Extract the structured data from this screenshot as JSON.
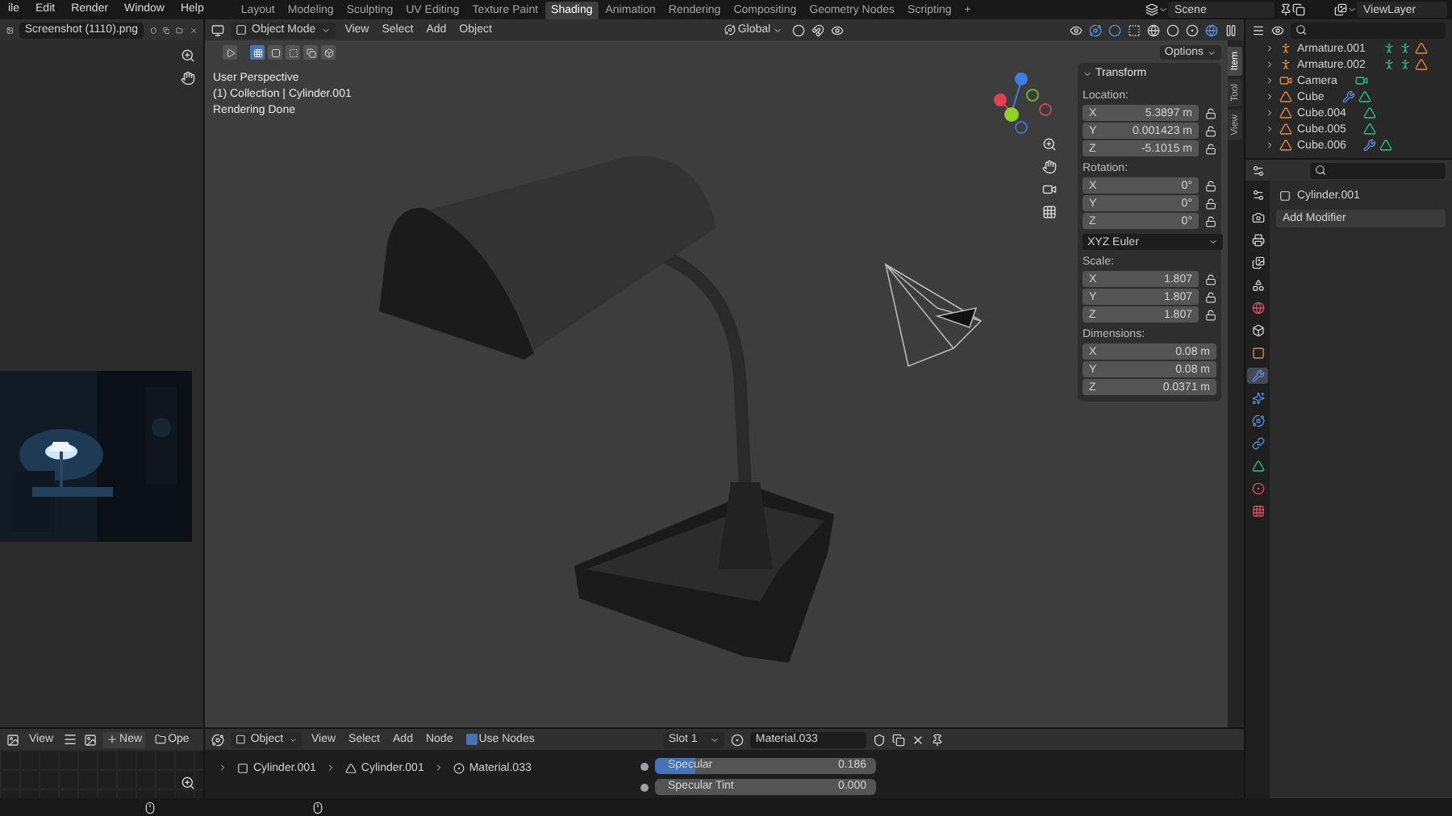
{
  "menus": [
    "ile",
    "Edit",
    "Render",
    "Window",
    "Help"
  ],
  "workspaces": [
    {
      "label": "Layout",
      "selected": false
    },
    {
      "label": "Modeling",
      "selected": false
    },
    {
      "label": "Sculpting",
      "selected": false
    },
    {
      "label": "UV Editing",
      "selected": false
    },
    {
      "label": "Texture Paint",
      "selected": false
    },
    {
      "label": "Shading",
      "selected": true
    },
    {
      "label": "Animation",
      "selected": false
    },
    {
      "label": "Rendering",
      "selected": false
    },
    {
      "label": "Compositing",
      "selected": false
    },
    {
      "label": "Geometry Nodes",
      "selected": false
    },
    {
      "label": "Scripting",
      "selected": false
    }
  ],
  "add_workspace": "+",
  "scene": {
    "name": "Scene",
    "view_layer": "ViewLayer"
  },
  "image_editor": {
    "image_name": "Screenshot (1110).png",
    "view": "View",
    "new": "New",
    "open": "Ope"
  },
  "viewport": {
    "mode": "Object Mode",
    "menus": [
      "View",
      "Select",
      "Add",
      "Object"
    ],
    "orientation": "Global",
    "options": "Options",
    "overlay": [
      "User Perspective",
      "(1) Collection | Cylinder.001",
      "Rendering Done"
    ]
  },
  "sidebar_tabs": [
    {
      "label": "Item",
      "selected": true
    },
    {
      "label": "Tool",
      "selected": false
    },
    {
      "label": "View",
      "selected": false
    }
  ],
  "transform": {
    "title": "Transform",
    "groups": [
      {
        "label": "Location:",
        "locks": true,
        "fields": [
          {
            "axis": "X",
            "value": "5.3897 m"
          },
          {
            "axis": "Y",
            "value": "0.001423 m"
          },
          {
            "axis": "Z",
            "value": "-5.1015 m"
          }
        ]
      },
      {
        "label": "Rotation:",
        "locks": true,
        "fields": [
          {
            "axis": "X",
            "value": "0°"
          },
          {
            "axis": "Y",
            "value": "0°"
          },
          {
            "axis": "Z",
            "value": "0°"
          }
        ],
        "dropdown": "XYZ Euler"
      },
      {
        "label": "Scale:",
        "locks": true,
        "fields": [
          {
            "axis": "X",
            "value": "1.807"
          },
          {
            "axis": "Y",
            "value": "1.807"
          },
          {
            "axis": "Z",
            "value": "1.807"
          }
        ]
      },
      {
        "label": "Dimensions:",
        "locks": false,
        "fields": [
          {
            "axis": "X",
            "value": "0.08 m"
          },
          {
            "axis": "Y",
            "value": "0.08 m"
          },
          {
            "axis": "Z",
            "value": "0.0371 m"
          }
        ]
      }
    ]
  },
  "outliner": [
    {
      "name": "Armature.001",
      "kind": "armature",
      "extras": [
        {
          "kind": "pose"
        },
        {
          "kind": "armature"
        },
        {
          "kind": "mesh"
        }
      ]
    },
    {
      "name": "Armature.002",
      "kind": "armature",
      "extras": [
        {
          "kind": "pose"
        },
        {
          "kind": "armature"
        },
        {
          "kind": "mesh"
        }
      ]
    },
    {
      "name": "Camera",
      "kind": "camera",
      "extras": [
        {
          "kind": "camera"
        }
      ]
    },
    {
      "name": "Cube",
      "kind": "mesh",
      "extras": [
        {
          "kind": "modifier"
        },
        {
          "kind": "data"
        }
      ]
    },
    {
      "name": "Cube.004",
      "kind": "mesh",
      "extras": [
        {
          "kind": "data"
        }
      ]
    },
    {
      "name": "Cube.005",
      "kind": "mesh",
      "extras": [
        {
          "kind": "data"
        }
      ]
    },
    {
      "name": "Cube.006",
      "kind": "mesh",
      "extras": [
        {
          "kind": "modifier"
        },
        {
          "kind": "data"
        }
      ]
    }
  ],
  "property_tabs": [
    {
      "kind": "tool",
      "selected": false
    },
    {
      "kind": "render",
      "selected": false
    },
    {
      "kind": "output",
      "selected": false
    },
    {
      "kind": "view_layer",
      "selected": false
    },
    {
      "kind": "scene",
      "selected": false
    },
    {
      "kind": "world",
      "selected": false
    },
    {
      "kind": "collection",
      "selected": false
    },
    {
      "kind": "object",
      "selected": false
    },
    {
      "kind": "modifier",
      "selected": true
    },
    {
      "kind": "particles",
      "selected": false
    },
    {
      "kind": "physics",
      "selected": false
    },
    {
      "kind": "constraints",
      "selected": false
    },
    {
      "kind": "data",
      "selected": false
    },
    {
      "kind": "material",
      "selected": false
    },
    {
      "kind": "texture",
      "selected": false
    }
  ],
  "properties": {
    "object": "Cylinder.001",
    "add_modifier": "Add Modifier"
  },
  "node_editor": {
    "type": "Object",
    "menus": [
      "View",
      "Select",
      "Add",
      "Node"
    ],
    "use_nodes": {
      "label": "Use Nodes",
      "checked": true
    },
    "slot": "Slot 1",
    "material": "Material.033",
    "breadcrumbs": [
      {
        "kind": "object",
        "label": "Cylinder.001"
      },
      {
        "kind": "mesh",
        "label": "Cylinder.001"
      },
      {
        "kind": "material",
        "label": "Material.033"
      }
    ],
    "sockets": [
      {
        "label": "Specular",
        "value": "0.186",
        "level": 0.186
      },
      {
        "label": "Specular Tint",
        "value": "0.000",
        "level": 0
      }
    ]
  }
}
